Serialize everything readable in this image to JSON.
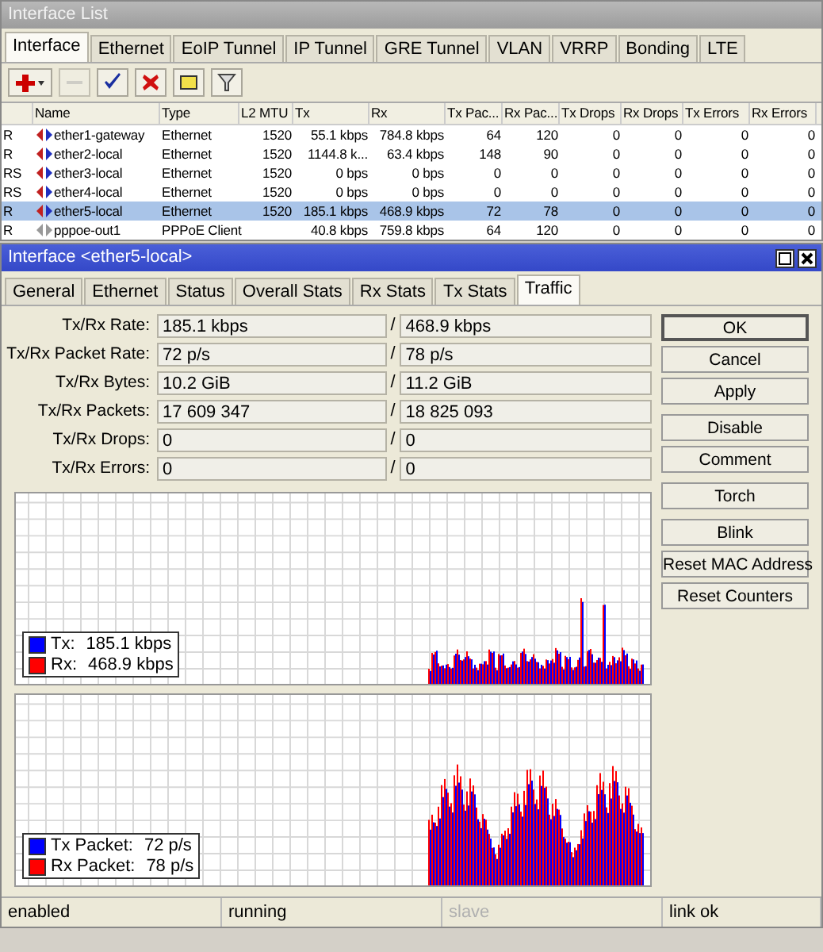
{
  "list_window": {
    "title": "Interface List",
    "tabs": [
      {
        "label": "Interface",
        "selected": true
      },
      {
        "label": "Ethernet",
        "selected": false
      },
      {
        "label": "EoIP Tunnel",
        "selected": false
      },
      {
        "label": "IP Tunnel",
        "selected": false
      },
      {
        "label": "GRE Tunnel",
        "selected": false
      },
      {
        "label": "VLAN",
        "selected": false
      },
      {
        "label": "VRRP",
        "selected": false
      },
      {
        "label": "Bonding",
        "selected": false
      },
      {
        "label": "LTE",
        "selected": false
      }
    ],
    "toolbar": [
      {
        "kind": "add",
        "disabled": false
      },
      {
        "kind": "remove",
        "disabled": true
      },
      {
        "kind": "enable",
        "disabled": false
      },
      {
        "kind": "disable",
        "disabled": false
      },
      {
        "kind": "comment",
        "disabled": false
      },
      {
        "kind": "filter",
        "disabled": false
      }
    ],
    "table": {
      "columns": [
        "",
        "Name",
        "Type",
        "L2 MTU",
        "Tx",
        "Rx",
        "Tx Pac...",
        "Rx Pac...",
        "Tx Drops",
        "Rx Drops",
        "Tx Errors",
        "Rx Errors"
      ],
      "rows": [
        {
          "flags": "R",
          "kind": "ethernet",
          "name": "ether1-gateway",
          "type": "Ethernet",
          "l2mtu": "1520",
          "tx": "55.1 kbps",
          "rx": "784.8 kbps",
          "tx_packets": "64",
          "rx_packets": "120",
          "tx_drops": "0",
          "rx_drops": "0",
          "tx_errors": "0",
          "rx_errors": "0",
          "selected": false
        },
        {
          "flags": "R",
          "kind": "ethernet",
          "name": "ether2-local",
          "type": "Ethernet",
          "l2mtu": "1520",
          "tx": "1144.8 k...",
          "rx": "63.4 kbps",
          "tx_packets": "148",
          "rx_packets": "90",
          "tx_drops": "0",
          "rx_drops": "0",
          "tx_errors": "0",
          "rx_errors": "0",
          "selected": false
        },
        {
          "flags": "RS",
          "kind": "ethernet",
          "name": "ether3-local",
          "type": "Ethernet",
          "l2mtu": "1520",
          "tx": "0 bps",
          "rx": "0 bps",
          "tx_packets": "0",
          "rx_packets": "0",
          "tx_drops": "0",
          "rx_drops": "0",
          "tx_errors": "0",
          "rx_errors": "0",
          "selected": false
        },
        {
          "flags": "RS",
          "kind": "ethernet",
          "name": "ether4-local",
          "type": "Ethernet",
          "l2mtu": "1520",
          "tx": "0 bps",
          "rx": "0 bps",
          "tx_packets": "0",
          "rx_packets": "0",
          "tx_drops": "0",
          "rx_drops": "0",
          "tx_errors": "0",
          "rx_errors": "0",
          "selected": false
        },
        {
          "flags": "R",
          "kind": "ethernet",
          "name": "ether5-local",
          "type": "Ethernet",
          "l2mtu": "1520",
          "tx": "185.1 kbps",
          "rx": "468.9 kbps",
          "tx_packets": "72",
          "rx_packets": "78",
          "tx_drops": "0",
          "rx_drops": "0",
          "tx_errors": "0",
          "rx_errors": "0",
          "selected": true
        },
        {
          "flags": "R",
          "kind": "pppoe",
          "name": "pppoe-out1",
          "type": "PPPoE Client",
          "tx": "40.8 kbps",
          "rx": "759.8 kbps",
          "tx_packets": "64",
          "rx_packets": "120",
          "tx_drops": "0",
          "rx_drops": "0",
          "tx_errors": "0",
          "rx_errors": "0",
          "selected": false
        }
      ]
    }
  },
  "dialog": {
    "title": "Interface <ether5-local>",
    "tabs": [
      {
        "label": "General",
        "selected": false
      },
      {
        "label": "Ethernet",
        "selected": false
      },
      {
        "label": "Status",
        "selected": false
      },
      {
        "label": "Overall Stats",
        "selected": false
      },
      {
        "label": "Rx Stats",
        "selected": false
      },
      {
        "label": "Tx Stats",
        "selected": false
      },
      {
        "label": "Traffic",
        "selected": true
      }
    ],
    "stats": [
      {
        "label": "Tx/Rx Rate:",
        "tx": "185.1 kbps",
        "rx": "468.9 kbps"
      },
      {
        "label": "Tx/Rx Packet Rate:",
        "tx": "72 p/s",
        "rx": "78 p/s"
      },
      {
        "label": "Tx/Rx Bytes:",
        "tx": "10.2 GiB",
        "rx": "11.2 GiB"
      },
      {
        "label": "Tx/Rx Packets:",
        "tx": "17 609 347",
        "rx": "18 825 093"
      },
      {
        "label": "Tx/Rx Drops:",
        "tx": "0",
        "rx": "0"
      },
      {
        "label": "Tx/Rx Errors:",
        "tx": "0",
        "rx": "0"
      }
    ],
    "separator": "/",
    "graphs": [
      {
        "legend": [
          {
            "label": "Tx:",
            "value": "185.1 kbps",
            "color": "#0000ff"
          },
          {
            "label": "Rx:",
            "value": "468.9 kbps",
            "color": "#ff0000"
          }
        ]
      },
      {
        "legend": [
          {
            "label": "Tx Packet:",
            "value": "72 p/s",
            "color": "#0000ff"
          },
          {
            "label": "Rx Packet:",
            "value": "78 p/s",
            "color": "#ff0000"
          }
        ]
      }
    ],
    "button_groups": [
      [
        {
          "label": "OK",
          "default": true
        },
        {
          "label": "Cancel",
          "default": false
        },
        {
          "label": "Apply",
          "default": false
        }
      ],
      [
        {
          "label": "Disable",
          "default": false
        },
        {
          "label": "Comment",
          "default": false
        }
      ],
      [
        {
          "label": "Torch",
          "default": false
        }
      ],
      [
        {
          "label": "Blink",
          "default": false
        },
        {
          "label": "Reset MAC Address",
          "default": false
        },
        {
          "label": "Reset Counters",
          "default": false
        }
      ]
    ],
    "status_bar": [
      {
        "text": "enabled",
        "disabled": false
      },
      {
        "text": "running",
        "disabled": false
      },
      {
        "text": "slave",
        "disabled": true
      },
      {
        "text": "link ok",
        "disabled": false
      }
    ]
  }
}
